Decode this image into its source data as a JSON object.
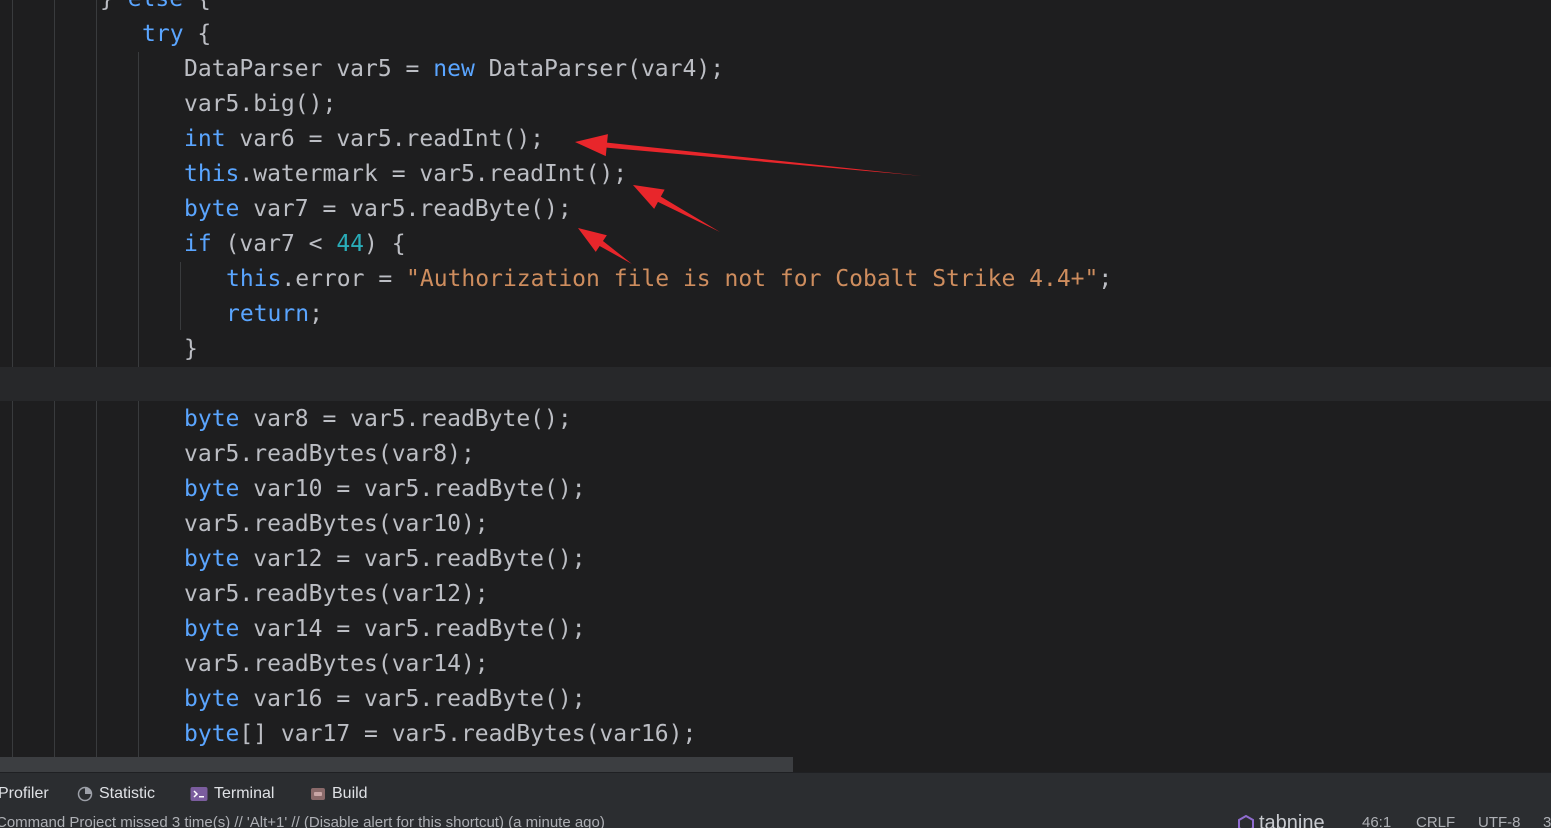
{
  "editor": {
    "lines": [
      [
        {
          "t": "} "
        },
        {
          "t": "else",
          "c": "kw"
        },
        {
          "t": " {"
        }
      ],
      [
        {
          "t": "try",
          "c": "kw"
        },
        {
          "t": " {"
        }
      ],
      [
        {
          "t": "DataParser var5 = "
        },
        {
          "t": "new",
          "c": "kw"
        },
        {
          "t": " DataParser(var4);"
        }
      ],
      [
        {
          "t": "var5.big();"
        }
      ],
      [
        {
          "t": "int",
          "c": "kw"
        },
        {
          "t": " var6 = var5.readInt();"
        }
      ],
      [
        {
          "t": "this",
          "c": "kw"
        },
        {
          "t": ".watermark = var5.readInt();"
        }
      ],
      [
        {
          "t": "byte",
          "c": "kw"
        },
        {
          "t": " var7 = var5.readByte();"
        }
      ],
      [
        {
          "t": "if",
          "c": "kw"
        },
        {
          "t": " (var7 < "
        },
        {
          "t": "44",
          "c": "num"
        },
        {
          "t": ") {"
        }
      ],
      [
        {
          "t": "this",
          "c": "kw"
        },
        {
          "t": ".error = "
        },
        {
          "t": "\"Authorization file is not for Cobalt Strike 4.4+\"",
          "c": "str"
        },
        {
          "t": ";"
        }
      ],
      [
        {
          "t": "return",
          "c": "kw"
        },
        {
          "t": ";"
        }
      ],
      [
        {
          "t": "}"
        }
      ],
      [],
      [
        {
          "t": "byte",
          "c": "kw"
        },
        {
          "t": " var8 = var5.readByte();"
        }
      ],
      [
        {
          "t": "var5.readBytes(var8);"
        }
      ],
      [
        {
          "t": "byte",
          "c": "kw"
        },
        {
          "t": " var10 = var5.readByte();"
        }
      ],
      [
        {
          "t": "var5.readBytes(var10);"
        }
      ],
      [
        {
          "t": "byte",
          "c": "kw"
        },
        {
          "t": " var12 = var5.readByte();"
        }
      ],
      [
        {
          "t": "var5.readBytes(var12);"
        }
      ],
      [
        {
          "t": "byte",
          "c": "kw"
        },
        {
          "t": " var14 = var5.readByte();"
        }
      ],
      [
        {
          "t": "var5.readBytes(var14);"
        }
      ],
      [
        {
          "t": "byte",
          "c": "kw"
        },
        {
          "t": " var16 = var5.readByte();"
        }
      ],
      [
        {
          "t": "byte",
          "c": "kw"
        },
        {
          "t": "[] var17 = var5.readBytes(var16);"
        }
      ]
    ],
    "annotation_color": "#e8262b"
  },
  "toolbar": {
    "profiler_label": "Profiler",
    "statistic_label": "Statistic",
    "terminal_label": "Terminal",
    "build_label": "Build"
  },
  "status": {
    "message": "Command Project missed 3 time(s) // 'Alt+1' // (Disable alert for this shortcut) (a minute ago)",
    "tabnine_label": "tabnine",
    "position": "46:1",
    "line_ending": "CRLF",
    "encoding": "UTF-8",
    "extra": "3"
  }
}
